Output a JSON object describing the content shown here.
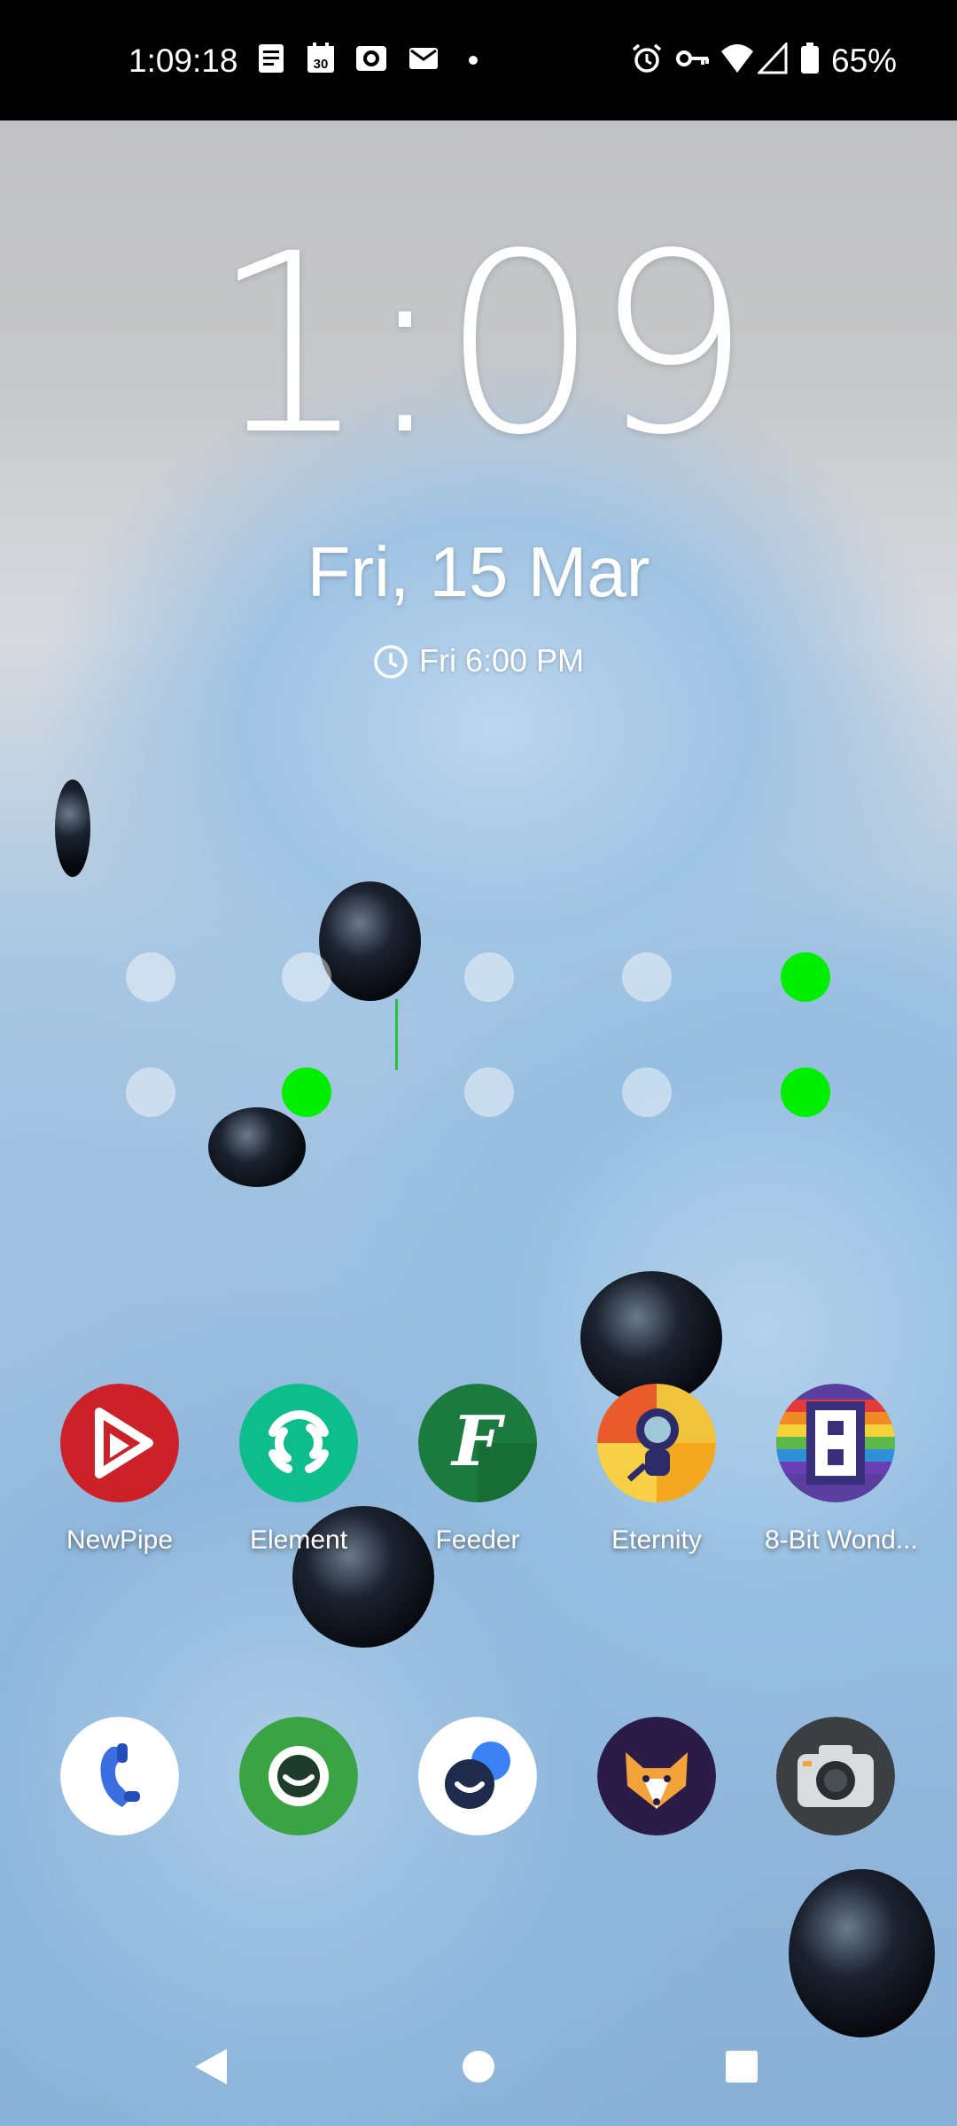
{
  "status_bar": {
    "time": "1:09:18",
    "battery_percent": "65%",
    "left_icons": [
      "notes-icon",
      "calendar-icon",
      "screen-record-icon",
      "mail-icon",
      "dot-icon"
    ],
    "right_icons": [
      "alarm-icon",
      "vpn-key-icon",
      "wifi-icon",
      "cell-signal-icon",
      "battery-icon"
    ],
    "calendar_day": "30"
  },
  "lockscreen": {
    "clock": "1:09",
    "date": "Fri, 15 Mar",
    "alarm": "Fri 6:00 PM"
  },
  "pattern": {
    "rows": 2,
    "cols": 5,
    "active": [
      [
        0,
        4
      ],
      [
        1,
        1
      ],
      [
        1,
        4
      ]
    ],
    "active_color": "#00ef00"
  },
  "apps_row1": [
    {
      "label": "NewPipe",
      "icon": "newpipe-icon",
      "color": "#cc2129"
    },
    {
      "label": "Element",
      "icon": "element-icon",
      "color": "#0dbd8b"
    },
    {
      "label": "Feeder",
      "icon": "feeder-icon",
      "color": "#1b7a3e"
    },
    {
      "label": "Eternity",
      "icon": "eternity-icon",
      "color": "#f3a81f"
    },
    {
      "label": "8-Bit Wond...",
      "icon": "8bit-wonders-icon",
      "color": "#5a3fa0"
    }
  ],
  "apps_dock": [
    {
      "icon": "phone-icon",
      "color": "#ffffff"
    },
    {
      "icon": "messaging-icon",
      "color": "#3aa444"
    },
    {
      "icon": "chat-icon",
      "color": "#ffffff"
    },
    {
      "icon": "fox-icon",
      "color": "#2a1b47"
    },
    {
      "icon": "camera-icon",
      "color": "#3b3f42"
    }
  ],
  "nav_bar": {
    "buttons": [
      "back-button",
      "home-button",
      "recents-button"
    ]
  }
}
